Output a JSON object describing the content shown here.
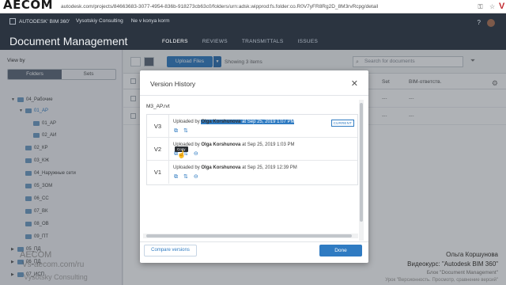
{
  "browser": {
    "logo": "AECOM",
    "url": "autodesk.com/projects/84663683-3077-4954-836b-918273cb63c0/folders/urn:adsk.wipprod:fs.folder:co.R0V7yFR8Rg2D_8M3rvRcpg/detail"
  },
  "header": {
    "brand": "AUTODESK' BIM 360'",
    "project": "Vysotskiy Consulting",
    "project_sub": "Ne v konya korm",
    "title": "Document Management",
    "tabs": [
      "FOLDERS",
      "REVIEWS",
      "TRANSMITTALS",
      "ISSUES"
    ]
  },
  "sidebar": {
    "view_by_label": "View by",
    "toggle": [
      "Folders",
      "Sets"
    ],
    "tree": [
      {
        "label": "04_Рабочие"
      },
      {
        "label": "01_АР"
      },
      {
        "label": "01_АР"
      },
      {
        "label": "02_АИ"
      },
      {
        "label": "02_КР"
      },
      {
        "label": "03_КЖ"
      },
      {
        "label": "04_Наружные сети"
      },
      {
        "label": "05_ЗОМ"
      },
      {
        "label": "06_СС"
      },
      {
        "label": "07_ВК"
      },
      {
        "label": "08_ОВ"
      },
      {
        "label": "09_ПТ"
      },
      {
        "label": "05_ПД"
      },
      {
        "label": "06_ПД"
      },
      {
        "label": "07_ИСП"
      }
    ]
  },
  "toolbar": {
    "upload_label": "Upload Files",
    "count_label": "Showing 3 items",
    "search_placeholder": "Search for documents"
  },
  "table": {
    "col_set": "Set",
    "col_bim": "BIM-ответств.",
    "rows": [
      {
        "set": "---",
        "bim": "---"
      },
      {
        "set": "---",
        "bim": "---"
      }
    ]
  },
  "modal": {
    "title": "Version History",
    "file_name": "M3_AP.rvt",
    "uploaded_prefix": "Uploaded by",
    "at_label": "at",
    "versions": [
      {
        "version": "V3",
        "user": "Olga Korshunova",
        "date": "Sep 25, 2019 1:07 PM",
        "badge": "CURRENT"
      },
      {
        "version": "V2",
        "user": "Olga Korshunova",
        "date": "Sep 25, 2019 1:03 PM"
      },
      {
        "version": "V1",
        "user": "Olga Korshunova",
        "date": "Sep 25, 2019 12:39 PM"
      }
    ],
    "tooltip": "Copy",
    "compare_label": "Compare versions",
    "done_label": "Done"
  },
  "watermark": {
    "left_1": "AECOM",
    "left_2": "Vs-aecom.com/ru",
    "left_3": "Vysotsky Consulting",
    "right_1": "Ольга Коршунова",
    "right_2": "Видеокурс: \"Autodesk BIM 360\"",
    "right_3": "Блок \"Document Management\"",
    "right_4": "Урок \"Версионность. Просмотр, сравнение версий\""
  }
}
